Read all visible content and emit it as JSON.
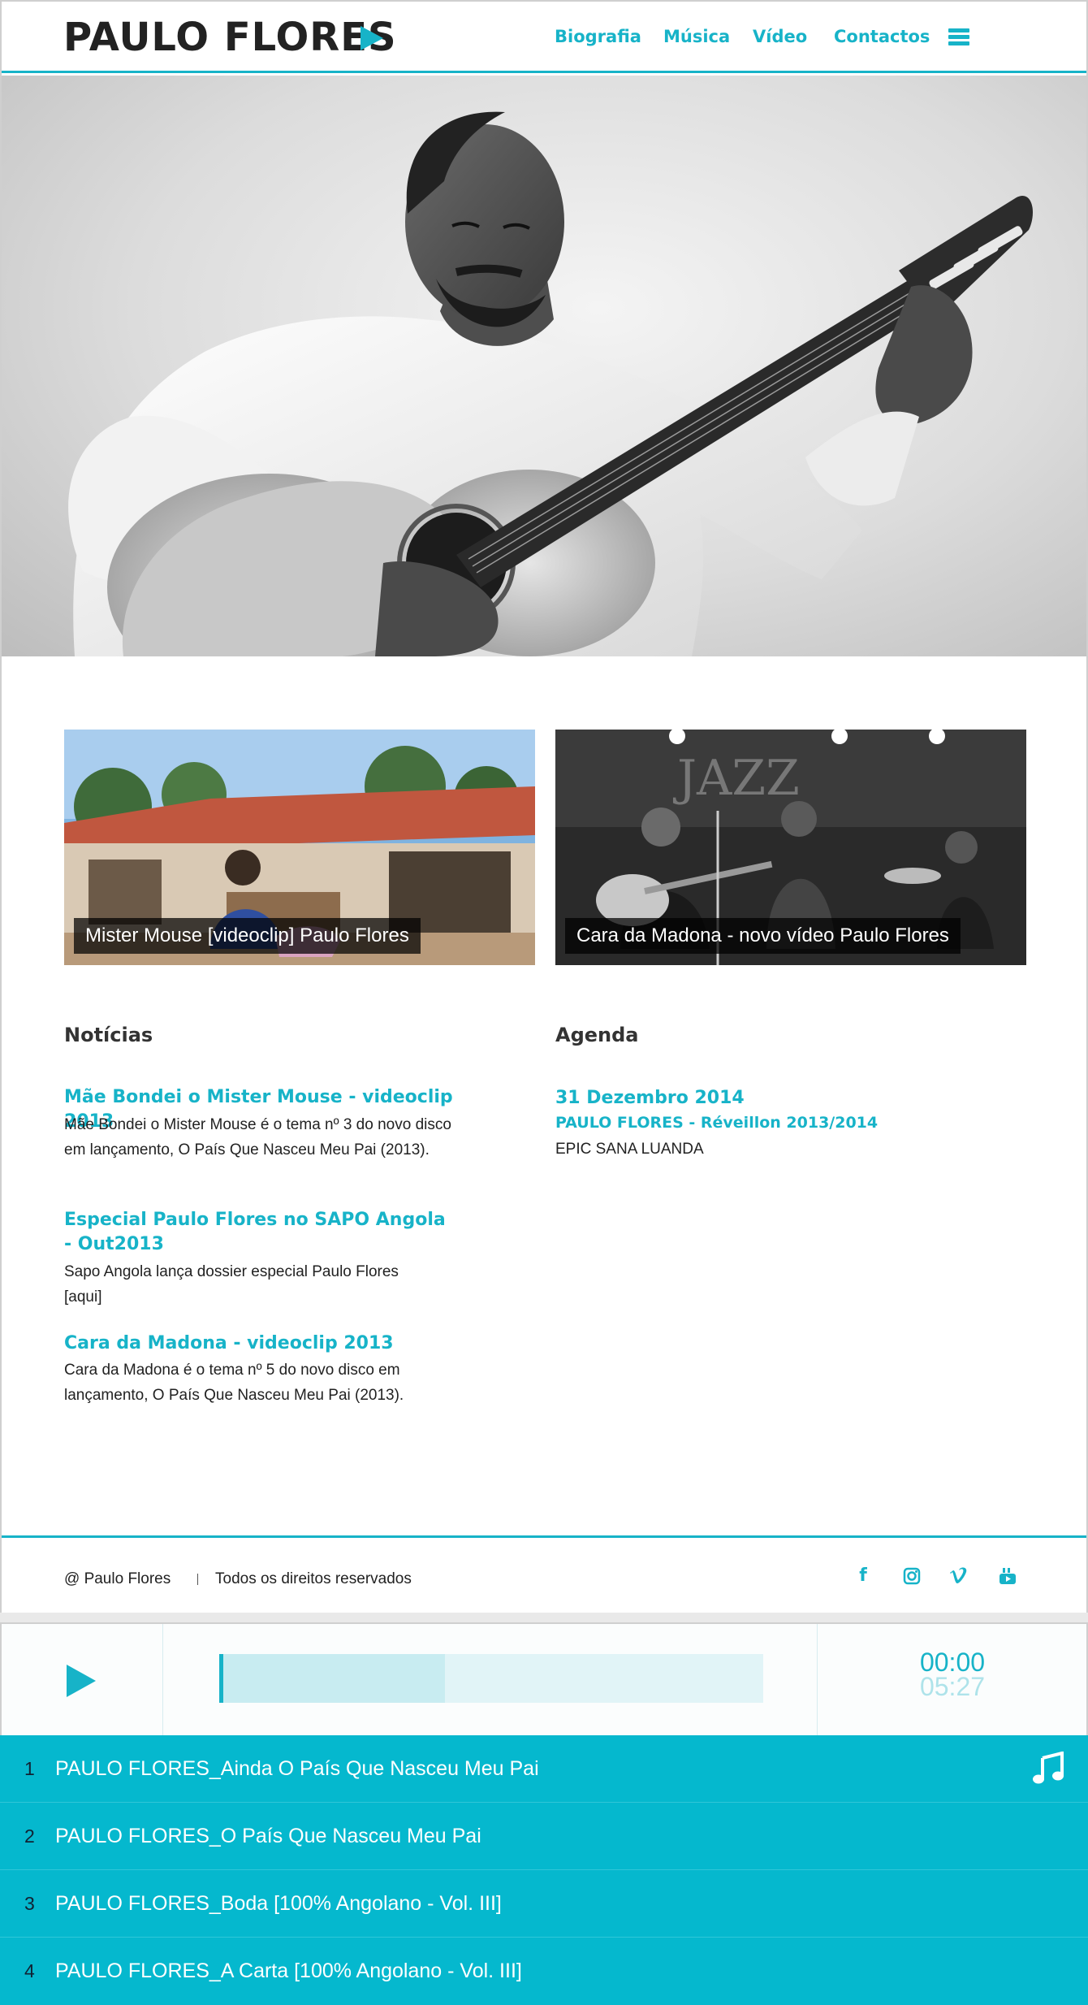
{
  "header": {
    "logo": "PAULO FLORES",
    "nav": [
      "Biografia",
      "Música",
      "Vídeo",
      "Contactos"
    ]
  },
  "videos": [
    {
      "caption": "Mister Mouse [videoclip] Paulo Flores"
    },
    {
      "caption": "Cara da Madona - novo vídeo Paulo Flores"
    }
  ],
  "news": {
    "title": "Notícias",
    "items": [
      {
        "title": "Mãe Bondei o Mister Mouse - videoclip 2013",
        "body": "Mãe Bondei o Mister Mouse é o tema nº 3 do novo disco em lançamento, O País Que Nasceu Meu Pai (2013)."
      },
      {
        "title": "Especial Paulo Flores no SAPO Angola - Out2013",
        "body": "Sapo Angola lança dossier especial Paulo Flores [aqui]"
      },
      {
        "title": "Cara da Madona - videoclip 2013",
        "body": "Cara da Madona é o tema nº 5 do novo disco em lançamento, O País Que Nasceu Meu Pai (2013)."
      }
    ]
  },
  "agenda": {
    "title": "Agenda",
    "date": "31 Dezembro 2014",
    "event": "PAULO FLORES - Réveillon 2013/2014",
    "place": "EPIC SANA LUANDA"
  },
  "footer": {
    "copyright": "@ Paulo Flores",
    "rights": "Todos os direitos reservados",
    "social": [
      "facebook-icon",
      "instagram-icon",
      "vimeo-icon",
      "youtube-icon"
    ]
  },
  "player": {
    "current_time": "00:00",
    "total_time": "05:27",
    "buffered_fraction": 0.415,
    "played_fraction": 0.0,
    "tracks": [
      {
        "num": "1",
        "title": "PAULO FLORES_Ainda O País Que Nasceu Meu Pai"
      },
      {
        "num": "2",
        "title": "PAULO FLORES_O País Que Nasceu Meu Pai"
      },
      {
        "num": "3",
        "title": "PAULO FLORES_Boda [100% Angolano - Vol. III]"
      },
      {
        "num": "4",
        "title": "PAULO FLORES_A Carta [100% Angolano - Vol. III]"
      }
    ]
  },
  "colors": {
    "accent": "#17b3c8",
    "playlist_bg": "#05b8ce"
  }
}
